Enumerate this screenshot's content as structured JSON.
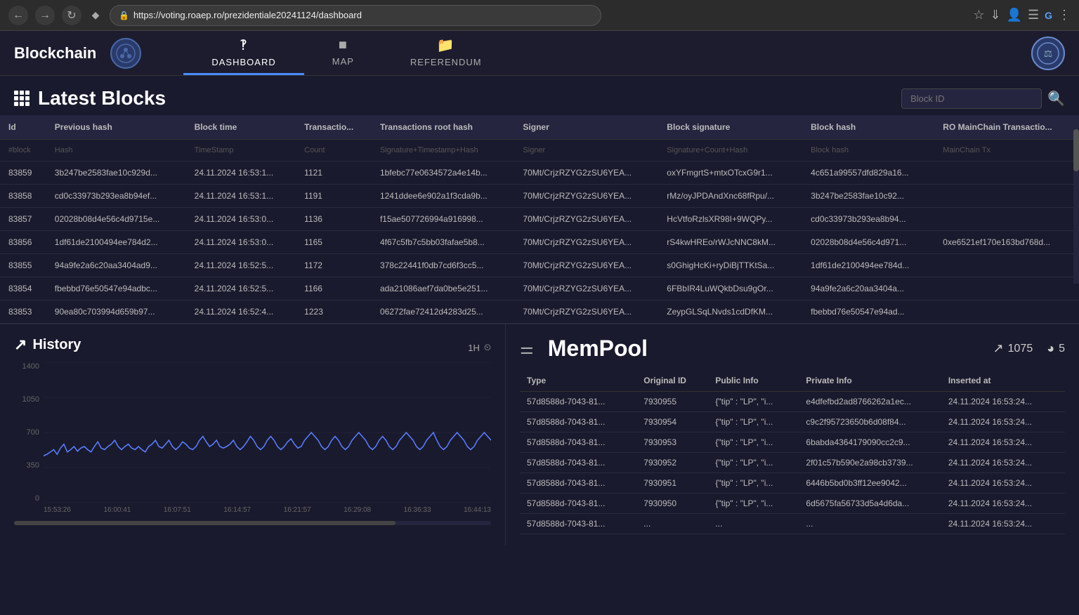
{
  "browser": {
    "url": "https://voting.roaep.ro/prezidentiale20241124/dashboard",
    "back_label": "←",
    "forward_label": "→",
    "refresh_label": "↻"
  },
  "app": {
    "title": "Blockchain",
    "nav_tabs": [
      {
        "id": "dashboard",
        "label": "DASHBOARD",
        "icon": "⊞",
        "active": true
      },
      {
        "id": "map",
        "label": "MAP",
        "icon": "🗺",
        "active": false
      },
      {
        "id": "referendum",
        "label": "REFERENDUM",
        "icon": "📁",
        "active": false
      }
    ]
  },
  "latest_blocks": {
    "title": "Latest Blocks",
    "search_placeholder": "Block ID",
    "columns": [
      "Id",
      "Previous hash",
      "Block time",
      "Transactio...",
      "Transactions root hash",
      "Signer",
      "Block signature",
      "Block hash",
      "RO MainChain Transactio..."
    ],
    "ghost_row": [
      "#block",
      "Hash",
      "TimeStamp",
      "Count",
      "Signature+Timestamp+Hash",
      "Signer",
      "Signature+Count+Hash",
      "Block hash",
      "MainChain Tx"
    ],
    "rows": [
      {
        "id": "83859",
        "prev_hash": "3b247be2583fae10c929d...",
        "block_time": "24.11.2024 16:53:1...",
        "transactions": "1121",
        "tx_root_hash": "1bfebc77e0634572a4e14b...",
        "signer": "70Mt/CrjzRZYG2zSU6YEA...",
        "block_sig": "oxYFmgrtS+mtxOTcxG9r1...",
        "block_hash": "4c651a99557dfd829a16...",
        "mainchain": ""
      },
      {
        "id": "83858",
        "prev_hash": "cd0c33973b293ea8b94ef...",
        "block_time": "24.11.2024 16:53:1...",
        "transactions": "1191",
        "tx_root_hash": "1241ddee6e902a1f3cda9b...",
        "signer": "70Mt/CrjzRZYG2zSU6YEA...",
        "block_sig": "rMz/oyJPDAndXnc68fRpu/...",
        "block_hash": "3b247be2583fae10c92...",
        "mainchain": ""
      },
      {
        "id": "83857",
        "prev_hash": "02028b08d4e56c4d9715e...",
        "block_time": "24.11.2024 16:53:0...",
        "transactions": "1136",
        "tx_root_hash": "f15ae507726994a916998...",
        "signer": "70Mt/CrjzRZYG2zSU6YEA...",
        "block_sig": "HcVtfoRzlsXR98I+9WQPy...",
        "block_hash": "cd0c33973b293ea8b94...",
        "mainchain": ""
      },
      {
        "id": "83856",
        "prev_hash": "1df61de2100494ee784d2...",
        "block_time": "24.11.2024 16:53:0...",
        "transactions": "1165",
        "tx_root_hash": "4f67c5fb7c5bb03fafae5b8...",
        "signer": "70Mt/CrjzRZYG2zSU6YEA...",
        "block_sig": "rS4kwHREo/rWJcNNC8kM...",
        "block_hash": "02028b08d4e56c4d971...",
        "mainchain": "0xe6521ef170e163bd768d..."
      },
      {
        "id": "83855",
        "prev_hash": "94a9fe2a6c20aa3404ad9...",
        "block_time": "24.11.2024 16:52:5...",
        "transactions": "1172",
        "tx_root_hash": "378c22441f0db7cd6f3cc5...",
        "signer": "70Mt/CrjzRZYG2zSU6YEA...",
        "block_sig": "s0GhigHcKi+ryDiBjTTKtSa...",
        "block_hash": "1df61de2100494ee784d...",
        "mainchain": ""
      },
      {
        "id": "83854",
        "prev_hash": "fbebbd76e50547e94adbc...",
        "block_time": "24.11.2024 16:52:5...",
        "transactions": "1166",
        "tx_root_hash": "ada21086aef7da0be5e251...",
        "signer": "70Mt/CrjzRZYG2zSU6YEA...",
        "block_sig": "6FBbIR4LuWQkbDsu9gOr...",
        "block_hash": "94a9fe2a6c20aa3404a...",
        "mainchain": ""
      },
      {
        "id": "83853",
        "prev_hash": "90ea80c703994d659b97...",
        "block_time": "24.11.2024 16:52:4...",
        "transactions": "1223",
        "tx_root_hash": "06272fae72412d4283d25...",
        "signer": "70Mt/CrjzRZYG2zSU6YEA...",
        "block_sig": "ZeypGLSqLNvds1cdDfKM...",
        "block_hash": "fbebbd76e50547e94ad...",
        "mainchain": ""
      }
    ]
  },
  "history": {
    "title": "History",
    "time_control": "1H",
    "y_labels": [
      "1400",
      "1050",
      "700",
      "350",
      "0"
    ],
    "x_labels": [
      "15:53:26",
      "16:00:41",
      "16:07:51",
      "16:14:57",
      "16:21:57",
      "16:29:08",
      "16:36:33",
      "16:44:13"
    ]
  },
  "mempool": {
    "title": "MemPool",
    "stat1_value": "1075",
    "stat2_value": "5",
    "columns": [
      "Type",
      "Original ID",
      "Public Info",
      "Private Info",
      "Inserted at"
    ],
    "rows": [
      {
        "type": "57d8588d-7043-81...",
        "original_id": "7930955",
        "public_info": "{\"tip\" : \"LP\", \"i...",
        "private_info": "e4dfefbd2ad8766262a1ec...",
        "inserted_at": "24.11.2024 16:53:24..."
      },
      {
        "type": "57d8588d-7043-81...",
        "original_id": "7930954",
        "public_info": "{\"tip\" : \"LP\", \"i...",
        "private_info": "c9c2f95723650b6d08f84...",
        "inserted_at": "24.11.2024 16:53:24..."
      },
      {
        "type": "57d8588d-7043-81...",
        "original_id": "7930953",
        "public_info": "{\"tip\" : \"LP\", \"i...",
        "private_info": "6babda4364179090cc2c9...",
        "inserted_at": "24.11.2024 16:53:24..."
      },
      {
        "type": "57d8588d-7043-81...",
        "original_id": "7930952",
        "public_info": "{\"tip\" : \"LP\", \"i...",
        "private_info": "2f01c57b590e2a98cb3739...",
        "inserted_at": "24.11.2024 16:53:24..."
      },
      {
        "type": "57d8588d-7043-81...",
        "original_id": "7930951",
        "public_info": "{\"tip\" : \"LP\", \"i...",
        "private_info": "6446b5bd0b3ff12ee9042...",
        "inserted_at": "24.11.2024 16:53:24..."
      },
      {
        "type": "57d8588d-7043-81...",
        "original_id": "7930950",
        "public_info": "{\"tip\" : \"LP\", \"i...",
        "private_info": "6d5675fa56733d5a4d6da...",
        "inserted_at": "24.11.2024 16:53:24..."
      },
      {
        "type": "57d8588d-7043-81...",
        "original_id": "...",
        "public_info": "...",
        "private_info": "...",
        "inserted_at": "24.11.2024 16:53:24..."
      }
    ]
  }
}
